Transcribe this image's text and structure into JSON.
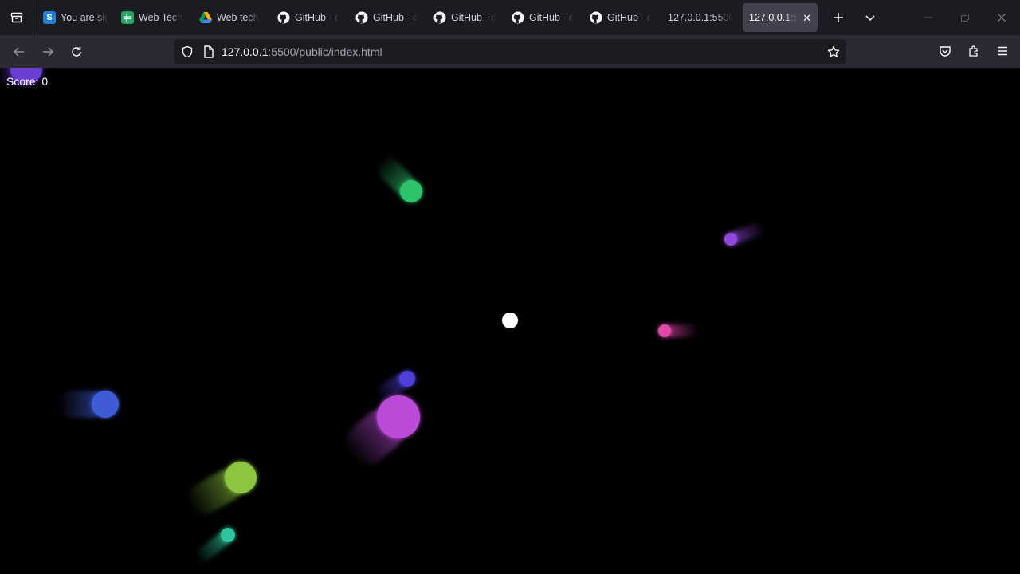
{
  "browser": {
    "tabs": [
      {
        "label": "You are sig",
        "icon": "sway-icon",
        "active": false
      },
      {
        "label": "Web Tech",
        "icon": "sheets-icon",
        "active": false
      },
      {
        "label": "Web tech",
        "icon": "drive-icon",
        "active": false
      },
      {
        "label": "GitHub - c",
        "icon": "github-icon",
        "active": false
      },
      {
        "label": "GitHub - c",
        "icon": "github-icon",
        "active": false
      },
      {
        "label": "GitHub - c",
        "icon": "github-icon",
        "active": false
      },
      {
        "label": "GitHub - c",
        "icon": "github-icon",
        "active": false
      },
      {
        "label": "GitHub - c",
        "icon": "github-icon",
        "active": false
      },
      {
        "label": "127.0.0.1:5500",
        "icon": "",
        "active": false
      },
      {
        "label": "127.0.0.1:55",
        "icon": "",
        "active": true
      }
    ],
    "url": {
      "host": "127.0.0.1",
      "rest": ":5500/public/index.html"
    }
  },
  "game": {
    "score_text": "Score: 0",
    "colors": {
      "background": "#000000",
      "player": "#ffffff",
      "enemies": [
        "#6a3fd6",
        "#2ec36a",
        "#9148dc",
        "#e24aa8",
        "#5140d8",
        "#3f5bd6",
        "#b94bd8",
        "#8cc641",
        "#2fc49e"
      ]
    }
  }
}
